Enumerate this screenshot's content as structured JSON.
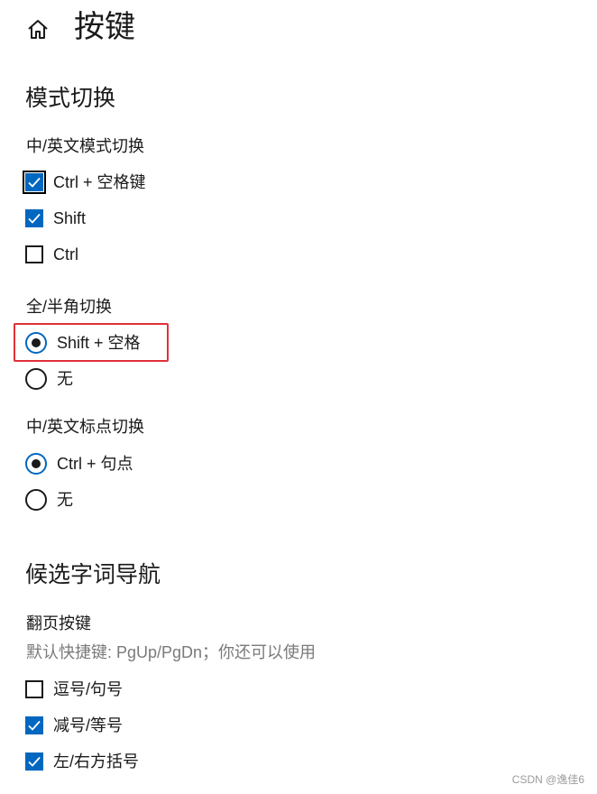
{
  "header": {
    "home_icon": "home-icon",
    "title": "按键"
  },
  "mode_switch": {
    "heading": "模式切换",
    "cn_en": {
      "label": "中/英文模式切换",
      "options": [
        {
          "label": "Ctrl + 空格键",
          "checked": true
        },
        {
          "label": "Shift",
          "checked": true
        },
        {
          "label": "Ctrl",
          "checked": false
        }
      ]
    },
    "full_half": {
      "label": "全/半角切换",
      "options": [
        {
          "label": "Shift + 空格",
          "selected": true
        },
        {
          "label": "无",
          "selected": false
        }
      ]
    },
    "punct": {
      "label": "中/英文标点切换",
      "options": [
        {
          "label": "Ctrl + 句点",
          "selected": true
        },
        {
          "label": "无",
          "selected": false
        }
      ]
    }
  },
  "candidate": {
    "heading": "候选字词导航",
    "paging_label": "翻页按键",
    "paging_hint": "默认快捷键: PgUp/PgDn；你还可以使用",
    "options": [
      {
        "label": "逗号/句号",
        "checked": false
      },
      {
        "label": "减号/等号",
        "checked": true
      },
      {
        "label": "左/右方括号",
        "checked": true
      }
    ]
  },
  "watermark": "CSDN @逸佳6",
  "colors": {
    "accent": "#0067c0",
    "highlight_border": "#e0313a"
  }
}
